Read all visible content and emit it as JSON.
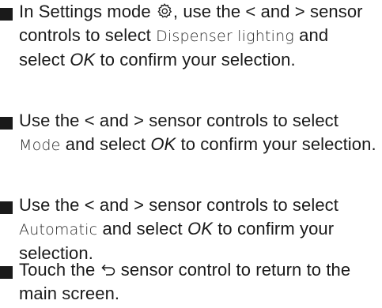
{
  "icons": {
    "bullet": "square-bullet",
    "settings": "gear-icon",
    "back": "back-arrow-icon"
  },
  "steps": [
    {
      "in_settings_mode": "In Settings mode",
      "use_the": ", use the < and > sensor controls to select",
      "target": "Dispenser lighting",
      "and_select": "and select",
      "ok": "OK",
      "confirm": "to confirm your selection."
    },
    {
      "use_the": "Use the < and > sensor controls to select",
      "target": "Mode",
      "and_select": "and select",
      "ok": "OK",
      "confirm": "to confirm your selection."
    },
    {
      "use_the": "Use the < and > sensor controls to select",
      "target": "Automatic",
      "and_select": "and select",
      "ok": "OK",
      "confirm": "to confirm your selection."
    },
    {
      "touch_the": "Touch the",
      "rest": "sensor control to return to the main screen."
    }
  ]
}
